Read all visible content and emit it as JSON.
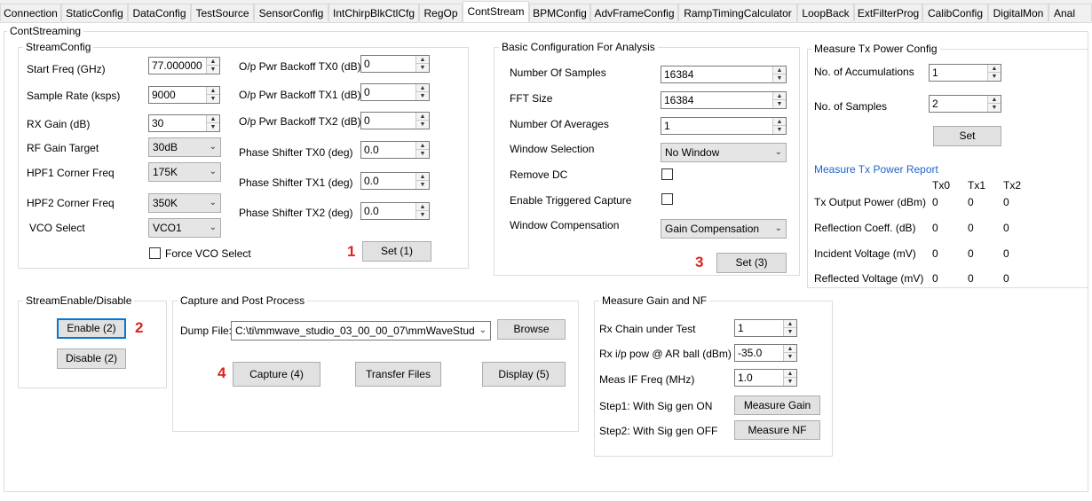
{
  "tabs": [
    "Connection",
    "StaticConfig",
    "DataConfig",
    "TestSource",
    "SensorConfig",
    "IntChirpBlkCtlCfg",
    "RegOp",
    "ContStream",
    "BPMConfig",
    "AdvFrameConfig",
    "RampTimingCalculator",
    "LoopBack",
    "ExtFilterProg",
    "CalibConfig",
    "DigitalMon",
    "Anal"
  ],
  "active_tab": "ContStream",
  "page_title": "ContStreaming",
  "stream_config": {
    "title": "StreamConfig",
    "start_freq_label": "Start Freq (GHz)",
    "start_freq": "77.000000",
    "sample_rate_label": "Sample Rate (ksps)",
    "sample_rate": "9000",
    "rx_gain_label": "RX Gain (dB)",
    "rx_gain": "30",
    "rf_gain_label": "RF Gain Target",
    "rf_gain": "30dB",
    "hpf1_label": "HPF1 Corner Freq",
    "hpf1": "175K",
    "hpf2_label": "HPF2 Corner Freq",
    "hpf2": "350K",
    "vco_label": "VCO Select",
    "vco": "VCO1",
    "force_vco_label": "Force VCO Select",
    "tx0_backoff_label": "O/p Pwr Backoff TX0 (dB)",
    "tx0_backoff": "0",
    "tx1_backoff_label": "O/p Pwr Backoff TX1 (dB)",
    "tx1_backoff": "0",
    "tx2_backoff_label": "O/p Pwr Backoff TX2 (dB)",
    "tx2_backoff": "0",
    "ps0_label": "Phase Shifter TX0 (deg)",
    "ps0": "0.0",
    "ps1_label": "Phase Shifter TX1 (deg)",
    "ps1": "0.0",
    "ps2_label": "Phase Shifter TX2 (deg)",
    "ps2": "0.0",
    "set_label": "Set (1)",
    "marker": "1"
  },
  "analysis": {
    "title": "Basic Configuration For Analysis",
    "num_samples_label": "Number Of Samples",
    "num_samples": "16384",
    "fft_size_label": "FFT Size",
    "fft_size": "16384",
    "num_avg_label": "Number Of Averages",
    "num_avg": "1",
    "window_label": "Window Selection",
    "window": "No Window",
    "remove_dc_label": "Remove DC",
    "trig_label": "Enable Triggered Capture",
    "win_comp_label": "Window Compensation",
    "win_comp": "Gain Compensation",
    "set_label": "Set (3)",
    "marker": "3"
  },
  "tx_power": {
    "title": "Measure Tx Power Config",
    "accum_label": "No. of Accumulations",
    "accum": "1",
    "samples_label": "No. of Samples",
    "samples": "2",
    "set_label": "Set",
    "report_title": "Measure Tx Power Report",
    "cols": [
      "Tx0",
      "Tx1",
      "Tx2"
    ],
    "rows": [
      {
        "label": "Tx Output Power (dBm)",
        "values": [
          "0",
          "0",
          "0"
        ]
      },
      {
        "label": "Reflection Coeff.  (dB)",
        "values": [
          "0",
          "0",
          "0"
        ]
      },
      {
        "label": "Incident Voltage (mV)",
        "values": [
          "0",
          "0",
          "0"
        ]
      },
      {
        "label": "Reflected Voltage (mV)",
        "values": [
          "0",
          "0",
          "0"
        ]
      }
    ]
  },
  "stream_enable": {
    "title": "StreamEnable/Disable",
    "enable_label": "Enable (2)",
    "disable_label": "Disable (2)",
    "marker": "2"
  },
  "capture": {
    "title": "Capture and Post Process",
    "dump_label": "Dump File:",
    "dump_path": "C:\\ti\\mmwave_studio_03_00_00_07\\mmWaveStudi",
    "browse_label": "Browse",
    "capture_label": "Capture (4)",
    "transfer_label": "Transfer Files",
    "display_label": "Display (5)",
    "marker": "4"
  },
  "gain_nf": {
    "title": "Measure Gain and NF",
    "rx_chain_label": "Rx Chain under Test",
    "rx_chain": "1",
    "rx_pow_label": "Rx i/p pow @ AR ball (dBm)",
    "rx_pow": "-35.0",
    "if_freq_label": "Meas IF Freq (MHz)",
    "if_freq": "1.0",
    "step1_label": "Step1: With Sig gen ON",
    "gain_btn": "Measure Gain",
    "step2_label": "Step2: With Sig gen OFF",
    "nf_btn": "Measure NF"
  },
  "colors": {
    "marker": "#e02020",
    "report_title": "#1e64c8",
    "focus": "#0078d7"
  }
}
